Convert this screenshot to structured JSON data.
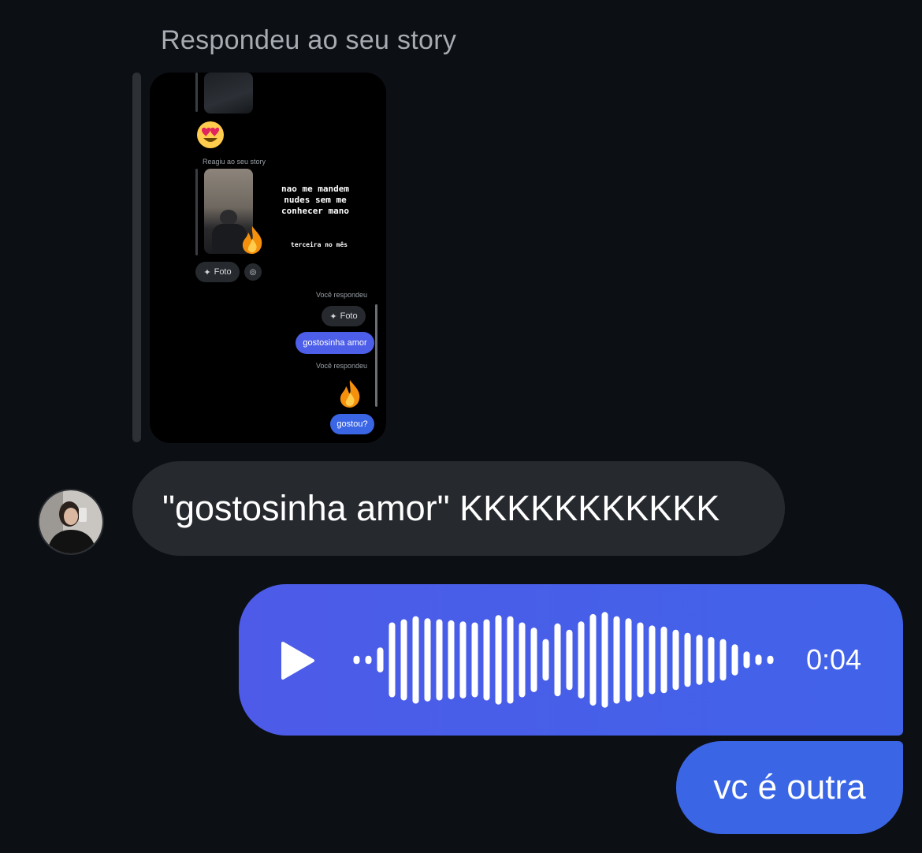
{
  "reply": {
    "label": "Respondeu ao seu story"
  },
  "story": {
    "reacted_label": "Reagiu ao seu story",
    "caption_line1": "nao me mandem",
    "caption_line2": "nudes sem me",
    "caption_line3": "conhecer mano",
    "caption_small": "terceira no mês",
    "photo_chip": "Foto",
    "you_replied_1": "Você respondeu",
    "photo_chip_2": "Foto",
    "reply_bubble": "gostosinha amor",
    "you_replied_2": "Você respondeu",
    "final_bubble": "gostou?"
  },
  "messages": {
    "incoming_text": "\"gostosinha amor\" KKKKKKKKKKK",
    "voice_duration": "0:04",
    "outgoing_text": "vc é outra"
  },
  "voice": {
    "bars": [
      0.08,
      0.08,
      0.24,
      0.72,
      0.78,
      0.84,
      0.8,
      0.78,
      0.76,
      0.74,
      0.72,
      0.78,
      0.86,
      0.84,
      0.72,
      0.62,
      0.4,
      0.7,
      0.58,
      0.74,
      0.88,
      0.92,
      0.84,
      0.8,
      0.72,
      0.66,
      0.64,
      0.58,
      0.52,
      0.48,
      0.44,
      0.4,
      0.3,
      0.16,
      0.1,
      0.08
    ]
  },
  "colors": {
    "background": "#0c0f14",
    "incoming_bubble": "#26292d",
    "voice_bubble": "#4163e9",
    "outgoing_bubble": "#3a66e5"
  },
  "icons": [
    "play-icon",
    "waveform-icon",
    "camera-icon",
    "photo-icon",
    "heart-eyes-emoji",
    "fire-emoji"
  ]
}
